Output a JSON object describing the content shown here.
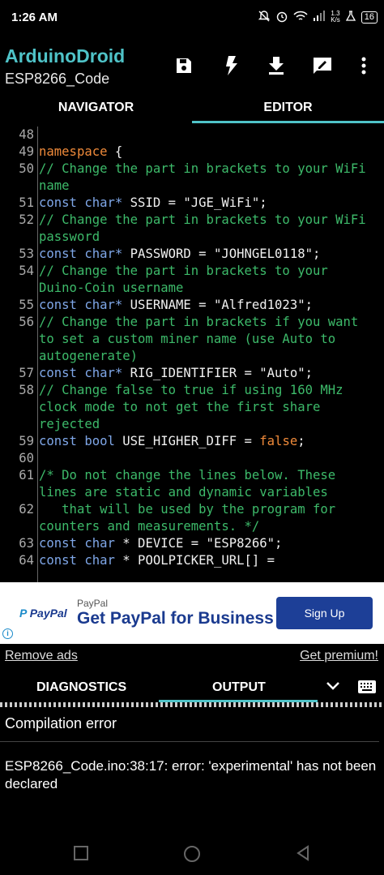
{
  "status": {
    "time": "1:26 AM",
    "speed_value": "1.3",
    "speed_unit": "K/s",
    "battery": "16"
  },
  "app": {
    "title": "ArduinoDroid",
    "subtitle": "ESP8266_Code"
  },
  "toolbar": {
    "icons": [
      "save-icon",
      "flash-icon",
      "download-icon",
      "edit-icon",
      "more-icon"
    ]
  },
  "tabs_top": {
    "navigator": "NAVIGATOR",
    "editor": "EDITOR",
    "active": "EDITOR"
  },
  "editor": {
    "lines": [
      {
        "n": "48",
        "segs": []
      },
      {
        "n": "49",
        "segs": [
          [
            "kw",
            "namespace"
          ],
          [
            "tx",
            " {"
          ]
        ]
      },
      {
        "n": "50",
        "segs": [
          [
            "cm",
            "// Change the part in brackets to your WiFi name"
          ]
        ]
      },
      {
        "n": "51",
        "segs": [
          [
            "ty",
            "const char*"
          ],
          [
            "tx",
            " SSID = \"JGE_WiFi\";"
          ]
        ]
      },
      {
        "n": "52",
        "segs": [
          [
            "cm",
            "// Change the part in brackets to your WiFi password"
          ]
        ]
      },
      {
        "n": "53",
        "segs": [
          [
            "ty",
            "const char*"
          ],
          [
            "tx",
            " PASSWORD = \"JOHNGEL0118\";"
          ]
        ]
      },
      {
        "n": "54",
        "segs": [
          [
            "cm",
            "// Change the part in brackets to your Duino-Coin username"
          ]
        ]
      },
      {
        "n": "55",
        "segs": [
          [
            "ty",
            "const char*"
          ],
          [
            "tx",
            " USERNAME = \"Alfred1023\";"
          ]
        ]
      },
      {
        "n": "56",
        "segs": [
          [
            "cm",
            "// Change the part in brackets if you want to set a custom miner name (use Auto to autogenerate)"
          ]
        ]
      },
      {
        "n": "57",
        "segs": [
          [
            "ty",
            "const char*"
          ],
          [
            "tx",
            " RIG_IDENTIFIER = \"Auto\";"
          ]
        ]
      },
      {
        "n": "58",
        "segs": [
          [
            "cm",
            "// Change false to true if using 160 MHz clock mode to not get the first share rejected"
          ]
        ]
      },
      {
        "n": "59",
        "segs": [
          [
            "ty",
            "const bool"
          ],
          [
            "tx",
            " USE_HIGHER_DIFF = "
          ],
          [
            "fl",
            "false"
          ],
          [
            "tx",
            ";"
          ]
        ]
      },
      {
        "n": "60",
        "segs": []
      },
      {
        "n": "61",
        "segs": [
          [
            "cm",
            "/* Do not change the lines below. These lines are static and dynamic variables"
          ]
        ]
      },
      {
        "n": "62",
        "segs": [
          [
            "cm",
            "   that will be used by the program for counters and measurements. */"
          ]
        ]
      },
      {
        "n": "63",
        "segs": [
          [
            "ty",
            "const char"
          ],
          [
            "tx",
            " * DEVICE = \"ESP8266\";"
          ]
        ]
      },
      {
        "n": "64",
        "segs": [
          [
            "ty",
            "const char"
          ],
          [
            "tx",
            " * POOLPICKER_URL[] ="
          ]
        ]
      }
    ]
  },
  "ad": {
    "logo": "PayPal",
    "small": "PayPal",
    "headline": "Get PayPal for Business",
    "cta": "Sign Up"
  },
  "links": {
    "remove_ads": "Remove ads",
    "premium": "Get premium!"
  },
  "tabs_bottom": {
    "diagnostics": "DIAGNOSTICS",
    "output": "OUTPUT",
    "active": "OUTPUT"
  },
  "output": {
    "heading": "Compilation error",
    "message": "ESP8266_Code.ino:38:17: error: 'experimental' has not been declared"
  },
  "colors": {
    "accent": "#4fc3c8",
    "keyword": "#ef8a3a",
    "type": "#7fa7e8",
    "comment": "#3dba6a",
    "paypal": "#1d3f97"
  }
}
